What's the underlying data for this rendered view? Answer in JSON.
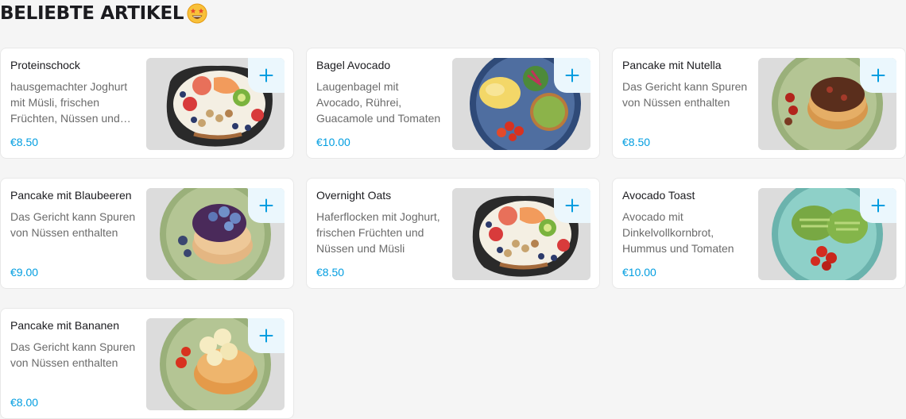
{
  "section": {
    "title": "BELIEBTE ARTIKEL",
    "emoji_icon": "star-struck-emoji-icon"
  },
  "colors": {
    "accent": "#009de0",
    "add_button_bg": "#ebf7fd",
    "page_bg": "#f5f5f5"
  },
  "items": [
    {
      "name": "Proteinschock",
      "description": "hausgemachter Joghurt mit Müsli, frischen Früchten, Nüssen und Haferflocken",
      "price": "€8.50",
      "image": "yogurt-bowl"
    },
    {
      "name": "Bagel Avocado",
      "description": "Laugenbagel mit Avocado, Rührei, Guacamole und Tomaten",
      "price": "€10.00",
      "image": "bagel-plate"
    },
    {
      "name": "Pancake mit Nutella",
      "description": "Das Gericht kann Spuren von Nüssen enthalten",
      "price": "€8.50",
      "image": "pancake-nutella"
    },
    {
      "name": "Pancake mit Blaubeeren",
      "description": "Das Gericht kann Spuren von Nüssen enthalten",
      "price": "€9.00",
      "image": "pancake-blueberry"
    },
    {
      "name": "Overnight Oats",
      "description": "Haferflocken mit Joghurt, frischen Früchten und Nüssen und Müsli",
      "price": "€8.50",
      "image": "yogurt-bowl"
    },
    {
      "name": "Avocado Toast",
      "description": "Avocado mit Dinkelvollkornbrot, Hummus und Tomaten",
      "price": "€10.00",
      "image": "avocado-toast"
    },
    {
      "name": "Pancake mit Bananen",
      "description": "Das Gericht kann Spuren von Nüssen enthalten",
      "price": "€8.00",
      "image": "pancake-banana"
    }
  ]
}
